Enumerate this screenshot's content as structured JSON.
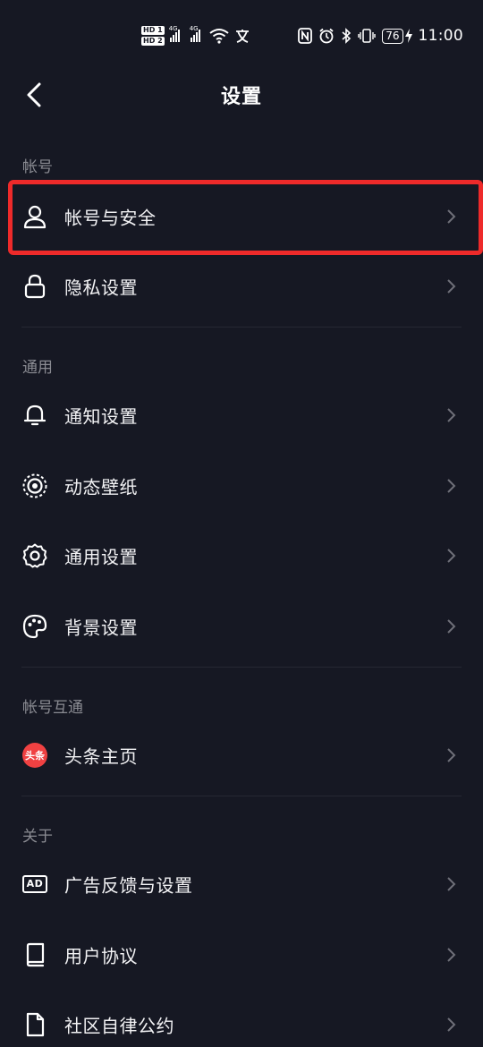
{
  "status_bar": {
    "hd1": "HD 1",
    "hd2": "HD 2",
    "sig1": "4G",
    "sig2": "4G",
    "battery": "76",
    "time": "11:00"
  },
  "header": {
    "title": "设置"
  },
  "sections": {
    "account": {
      "label": "帐号",
      "items": [
        {
          "label": "帐号与安全",
          "icon": "person-icon"
        },
        {
          "label": "隐私设置",
          "icon": "lock-icon"
        }
      ]
    },
    "general": {
      "label": "通用",
      "items": [
        {
          "label": "通知设置",
          "icon": "bell-icon"
        },
        {
          "label": "动态壁纸",
          "icon": "live-wallpaper-icon"
        },
        {
          "label": "通用设置",
          "icon": "gear-icon"
        },
        {
          "label": "背景设置",
          "icon": "palette-icon"
        }
      ]
    },
    "linked": {
      "label": "帐号互通",
      "items": [
        {
          "label": "头条主页",
          "icon": "toutiao-icon",
          "badge": "头条"
        }
      ]
    },
    "about": {
      "label": "关于",
      "items": [
        {
          "label": "广告反馈与设置",
          "icon": "ad-icon",
          "badge": "AD"
        },
        {
          "label": "用户协议",
          "icon": "book-icon"
        },
        {
          "label": "社区自律公约",
          "icon": "document-icon"
        }
      ]
    }
  },
  "colors": {
    "background": "#161823",
    "highlight": "#ee2a2a",
    "section_label": "#8a8b92",
    "toutiao": "#f04142"
  }
}
